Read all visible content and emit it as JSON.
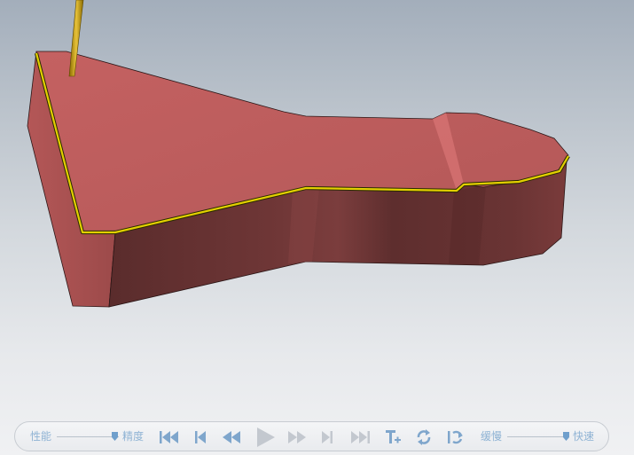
{
  "viewport": {
    "part_color": "#b95b5b",
    "side_color": "#6b3434",
    "edge_highlight_color": "#d4c300",
    "tool_color": "#c9a300"
  },
  "playbar": {
    "performance_label": "性能",
    "precision_label": "精度",
    "slow_label": "缓慢",
    "fast_label": "快速",
    "accent_color": "#8fb3d4",
    "controls": [
      {
        "name": "skip-to-start-icon"
      },
      {
        "name": "step-back-icon"
      },
      {
        "name": "rewind-icon"
      },
      {
        "name": "play-icon"
      },
      {
        "name": "fast-forward-icon"
      },
      {
        "name": "step-forward-icon"
      },
      {
        "name": "skip-to-end-icon"
      },
      {
        "name": "add-tool-icon"
      },
      {
        "name": "loop-icon"
      },
      {
        "name": "reverse-loop-icon"
      }
    ]
  }
}
